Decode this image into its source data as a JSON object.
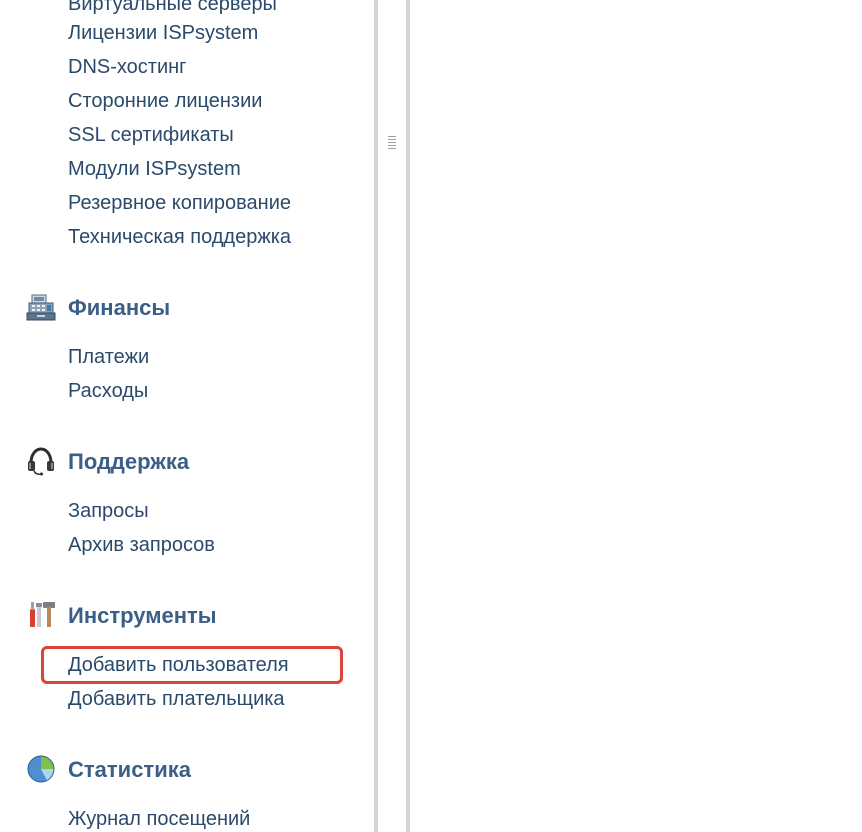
{
  "sidebar": {
    "top_items": [
      "Виртуальные серверы",
      "Лицензии ISPsystem",
      "DNS-хостинг",
      "Сторонние лицензии",
      "SSL сертификаты",
      "Модули ISPsystem",
      "Резервное копирование",
      "Техническая поддержка"
    ],
    "sections": [
      {
        "title": "Финансы",
        "icon": "cash-register-icon",
        "items": [
          "Платежи",
          "Расходы"
        ]
      },
      {
        "title": "Поддержка",
        "icon": "headset-icon",
        "items": [
          "Запросы",
          "Архив запросов"
        ]
      },
      {
        "title": "Инструменты",
        "icon": "tools-icon",
        "items": [
          "Добавить пользователя",
          "Добавить плательщика"
        ]
      },
      {
        "title": "Статистика",
        "icon": "pie-chart-icon",
        "items": [
          "Журнал посещений"
        ]
      }
    ]
  },
  "colors": {
    "link": "#2b4a6b",
    "section_title": "#3c5f86",
    "highlight": "#d7453a"
  }
}
